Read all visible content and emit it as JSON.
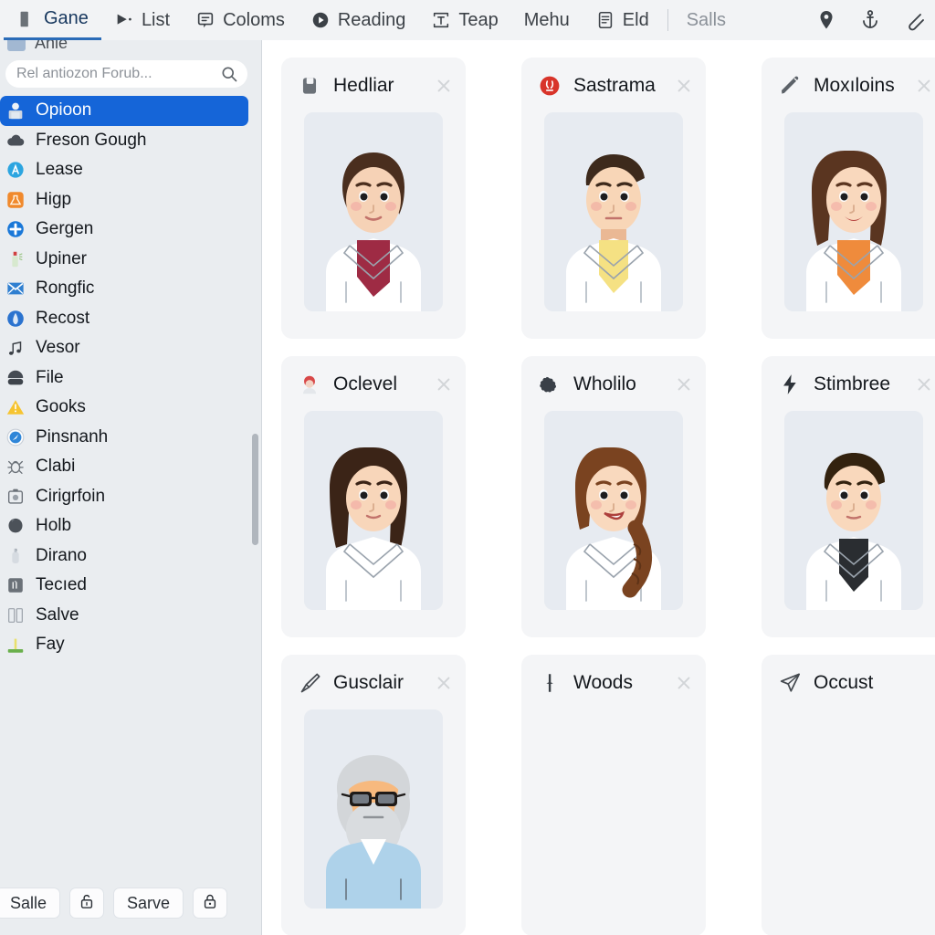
{
  "toolbar": {
    "items": [
      {
        "label": "Gane",
        "icon": "square-tab-icon",
        "state": "active"
      },
      {
        "label": "List",
        "icon": "play-list-icon",
        "state": "normal"
      },
      {
        "label": "Coloms",
        "icon": "comment-box-icon",
        "state": "normal"
      },
      {
        "label": "Reading",
        "icon": "play-circle-icon",
        "state": "normal"
      },
      {
        "label": "Teap",
        "icon": "text-frame-icon",
        "state": "normal"
      },
      {
        "label": "Mehu",
        "icon": "none",
        "state": "normal"
      },
      {
        "label": "Eld",
        "icon": "document-icon",
        "state": "normal"
      },
      {
        "label": "Salls",
        "icon": "none",
        "state": "muted"
      }
    ],
    "right_icons": [
      "location-pin-icon",
      "anchor-icon",
      "paperclip-icon"
    ],
    "accent_color": "#2b6cb8",
    "background_color": "#f2f3f5"
  },
  "sidebar": {
    "ghost_item_label": "Anie",
    "search": {
      "placeholder": "Rel antiozon Forub...",
      "value": "",
      "icon": "search-icon"
    },
    "items": [
      {
        "label": "Opioon",
        "icon": "user-badge-icon",
        "selected": true
      },
      {
        "label": "Freson Gough",
        "icon": "cloud-dark-icon",
        "selected": false
      },
      {
        "label": "Lease",
        "icon": "letter-a-circle-icon",
        "selected": false
      },
      {
        "label": "Higp",
        "icon": "orange-flask-icon",
        "selected": false
      },
      {
        "label": "Gergen",
        "icon": "plus-circle-icon",
        "selected": false
      },
      {
        "label": "Upiner",
        "icon": "spray-can-icon",
        "selected": false
      },
      {
        "label": "Rongfic",
        "icon": "envelope-icon",
        "selected": false
      },
      {
        "label": "Recost",
        "icon": "blue-figure-icon",
        "selected": false
      },
      {
        "label": "Vesor",
        "icon": "music-note-icon",
        "selected": false
      },
      {
        "label": "File",
        "icon": "dark-dome-icon",
        "selected": false
      },
      {
        "label": "Gooks",
        "icon": "warning-triangle-icon",
        "selected": false
      },
      {
        "label": "Pinsnanh",
        "icon": "compass-icon",
        "selected": false
      },
      {
        "label": "Clabi",
        "icon": "bug-outline-icon",
        "selected": false
      },
      {
        "label": "Cirigrfoin",
        "icon": "camera-frame-icon",
        "selected": false
      },
      {
        "label": "Holb",
        "icon": "dark-blob-icon",
        "selected": false
      },
      {
        "label": "Dirano",
        "icon": "flask-bottle-icon",
        "selected": false
      },
      {
        "label": "Tecıed",
        "icon": "gray-square-icon",
        "selected": false
      },
      {
        "label": "Salve",
        "icon": "two-columns-icon",
        "selected": false
      },
      {
        "label": "Fay",
        "icon": "green-plant-icon",
        "selected": false
      }
    ],
    "selected_color": "#1565d8",
    "footer": [
      {
        "label": "Salle",
        "icon": "none",
        "type": "text"
      },
      {
        "label": "",
        "icon": "lock-open-icon",
        "type": "icon"
      },
      {
        "label": "Sarve",
        "icon": "none",
        "type": "text"
      },
      {
        "label": "",
        "icon": "lock-closed-icon",
        "type": "icon"
      }
    ]
  },
  "cards": [
    {
      "title": "Hedliar",
      "icon": "save-disk-icon",
      "close": "close-icon",
      "avatar": "woman-short-brown-hair-redtop",
      "empty": false
    },
    {
      "title": "Sastrama",
      "icon": "red-badge-icon",
      "close": "close-icon",
      "avatar": "man-spiky-dark-hair-yellowtop",
      "empty": false
    },
    {
      "title": "Moxıloins",
      "icon": "pen-icon",
      "close": "close-icon",
      "avatar": "woman-long-brown-hair-orangetop",
      "empty": false
    },
    {
      "title": "Oclevel",
      "icon": "red-hood-icon",
      "close": "close-icon",
      "avatar": "woman-long-dark-hair-whitecoat",
      "empty": false
    },
    {
      "title": "Wholilo",
      "icon": "dark-splat-icon",
      "close": "close-icon",
      "avatar": "woman-braid-auburn-hair",
      "empty": false
    },
    {
      "title": "Stimbree",
      "icon": "lightning-icon",
      "close": "close-icon",
      "avatar": "man-dark-hair-blacktop",
      "empty": false
    },
    {
      "title": "Gusclair",
      "icon": "pen-nib-icon",
      "close": "close-icon",
      "avatar": "elderly-man-glasses-beard",
      "empty": false
    },
    {
      "title": "Woods",
      "icon": "tree-icon",
      "close": "close-icon",
      "avatar": "none",
      "empty": true
    },
    {
      "title": "Occust",
      "icon": "paper-plane-icon",
      "close": "none",
      "avatar": "none",
      "empty": true
    }
  ],
  "theme": {
    "card_background": "#f4f5f7",
    "photo_background": "#e7ebf1",
    "sidebar_background": "#eaedf0",
    "content_background": "#ffffff"
  }
}
